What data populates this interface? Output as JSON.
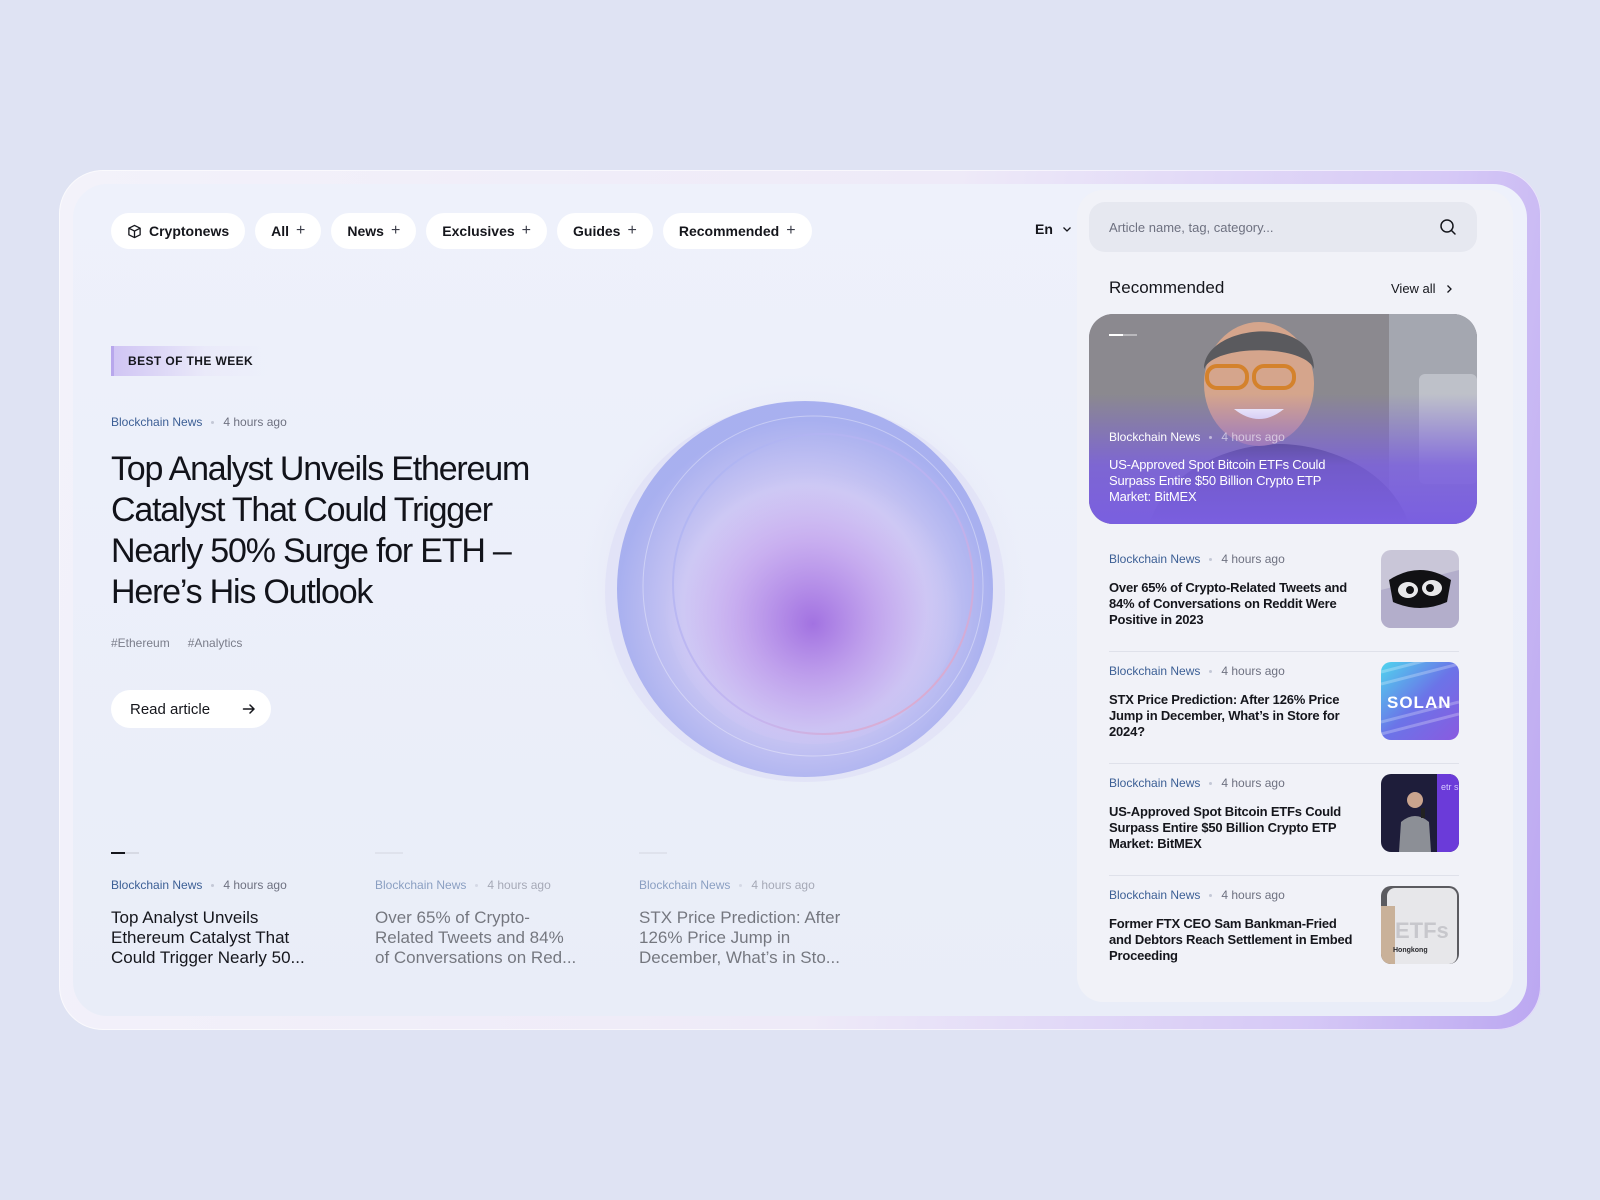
{
  "nav": {
    "brand": "Cryptonews",
    "items": [
      {
        "label": "All"
      },
      {
        "label": "News"
      },
      {
        "label": "Exclusives"
      },
      {
        "label": "Guides"
      },
      {
        "label": "Recommended"
      }
    ],
    "language": "En"
  },
  "hero": {
    "badge": "BEST OF THE WEEK",
    "category": "Blockchain News",
    "time": "4 hours ago",
    "title": "Top Analyst Unveils Ethereum Catalyst That Could Trigger Nearly 50% Surge for ETH – Here’s His Outlook",
    "tags": [
      "#Ethereum",
      "#Analytics"
    ],
    "cta": "Read article"
  },
  "bottom_articles": [
    {
      "category": "Blockchain News",
      "time": "4 hours ago",
      "title": "Top Analyst Unveils Ethereum Catalyst That Could Trigger Nearly 50..."
    },
    {
      "category": "Blockchain News",
      "time": "4 hours ago",
      "title": "Over 65% of Crypto-Related Tweets and 84% of Conversations on Red..."
    },
    {
      "category": "Blockchain News",
      "time": "4 hours ago",
      "title": "STX Price Prediction: After 126% Price Jump in December, What’s in Sto..."
    }
  ],
  "sidebar": {
    "search_placeholder": "Article name, tag, category...",
    "heading": "Recommended",
    "view_all": "View all",
    "featured": {
      "category": "Blockchain News",
      "time": "4 hours ago",
      "title": "US-Approved Spot Bitcoin ETFs Could Surpass Entire $50 Billion Crypto ETP Market: BitMEX"
    },
    "items": [
      {
        "category": "Blockchain News",
        "time": "4 hours ago",
        "title": "Over 65% of Crypto-Related Tweets and 84% of Conversations on Reddit Were Positive in 2023"
      },
      {
        "category": "Blockchain News",
        "time": "4 hours ago",
        "title": "STX Price Prediction: After 126% Price Jump in December, What’s in Store for 2024?",
        "thumb_text": "SOLAN"
      },
      {
        "category": "Blockchain News",
        "time": "4 hours ago",
        "title": "US-Approved Spot Bitcoin ETFs Could Surpass Entire $50 Billion Crypto ETP Market: BitMEX",
        "thumb_text": "etr su"
      },
      {
        "category": "Blockchain News",
        "time": "4 hours ago",
        "title": "Former FTX CEO Sam Bankman-Fried and Debtors Reach Settlement in Embed Proceeding",
        "thumb_text": "ETFs",
        "thumb_subtext": "Hongkong"
      }
    ]
  },
  "colors": {
    "background": "#dfe3f3",
    "accent": "#7a5fe0",
    "category": "#3c5f95"
  }
}
